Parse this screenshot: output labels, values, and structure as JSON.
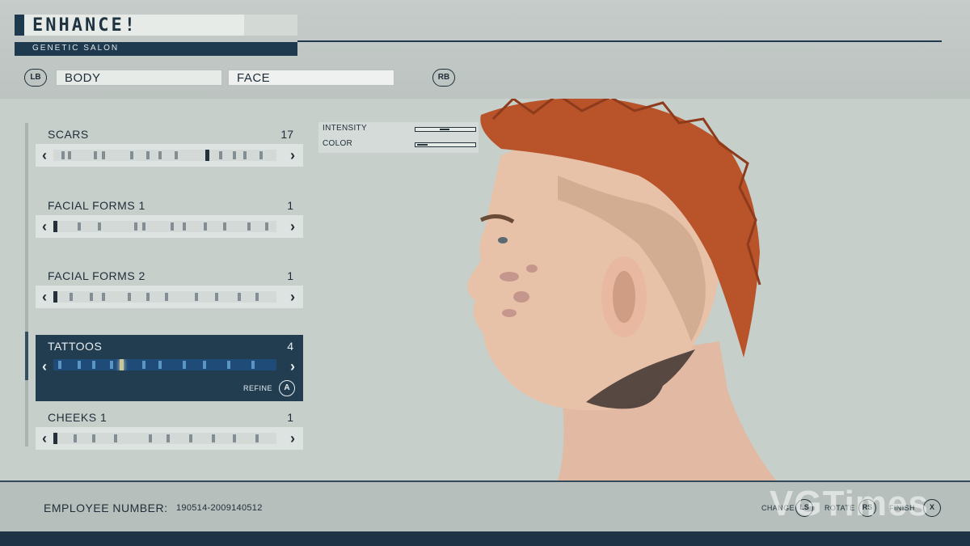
{
  "header": {
    "title": "ENHANCE!",
    "subtitle": "GENETIC SALON"
  },
  "nav": {
    "left_bumper": "LB",
    "right_bumper": "RB",
    "tabs": [
      {
        "label": "BODY",
        "active": false
      },
      {
        "label": "FACE",
        "active": true
      }
    ]
  },
  "sliders": [
    {
      "label": "SCARS",
      "value": "17",
      "active": false
    },
    {
      "label": "FACIAL FORMS 1",
      "value": "1",
      "active": false
    },
    {
      "label": "FACIAL FORMS 2",
      "value": "1",
      "active": false
    },
    {
      "label": "TATTOOS",
      "value": "4",
      "active": true
    },
    {
      "label": "CHEEKS 1",
      "value": "1",
      "active": false
    }
  ],
  "refine": {
    "label": "REFINE",
    "button": "A"
  },
  "tweaks": [
    {
      "label": "INTENSITY",
      "level": 0.5
    },
    {
      "label": "COLOR",
      "level": 0.18
    }
  ],
  "footer": {
    "employee_label": "EMPLOYEE NUMBER:",
    "employee_number": "190514-2009140512",
    "hints": [
      {
        "label": "CHANGE",
        "button": "LS"
      },
      {
        "label": "ROTATE",
        "button": "RS"
      },
      {
        "label": "FINISH",
        "button": "X"
      }
    ]
  },
  "watermark": "VGTimes",
  "colors": {
    "accent": "#1f3a4e",
    "selected_row": "#223c50",
    "hair": "#b8532a"
  }
}
